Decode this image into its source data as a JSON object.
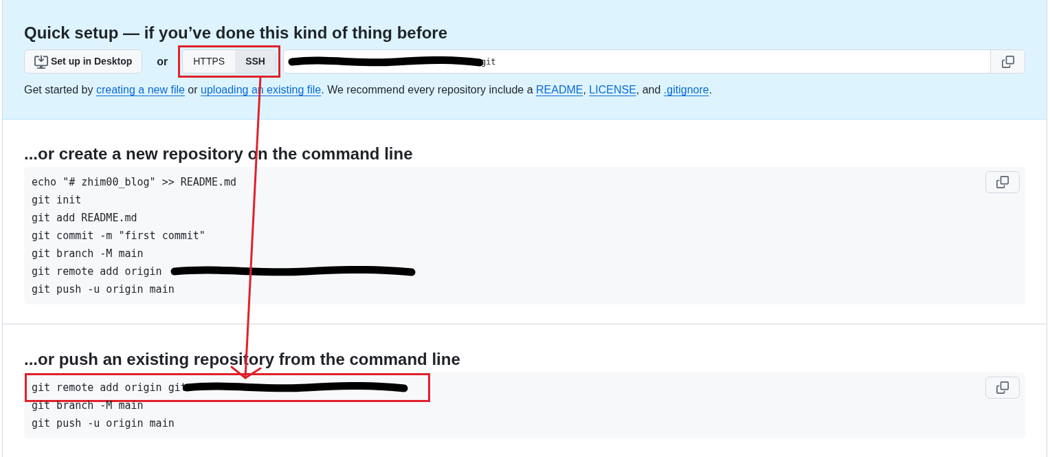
{
  "quick_setup": {
    "title": "Quick setup — if you’ve done this kind of thing before",
    "desktop_button": "Set up in Desktop",
    "separator": "or",
    "protocols_annotated": true,
    "protocols": [
      {
        "label": "HTTPS",
        "selected": false
      },
      {
        "label": "SSH",
        "selected": true
      }
    ],
    "url": {
      "visible_text": "git",
      "redacted": true
    },
    "hint": [
      {
        "text": "Get started by ",
        "kind": "text"
      },
      {
        "text": "creating a new file",
        "kind": "link"
      },
      {
        "text": " or ",
        "kind": "text"
      },
      {
        "text": "uploading an existing file",
        "kind": "link"
      },
      {
        "text": ". We recommend every repository include a ",
        "kind": "text"
      },
      {
        "text": "README",
        "kind": "link"
      },
      {
        "text": ", ",
        "kind": "text"
      },
      {
        "text": "LICENSE",
        "kind": "link"
      },
      {
        "text": ", and ",
        "kind": "text"
      },
      {
        "text": ".gitignore",
        "kind": "link"
      },
      {
        "text": ".",
        "kind": "text"
      }
    ]
  },
  "sections": [
    {
      "title": "...or create a new repository on the command line",
      "lines": [
        {
          "text": "echo \"# zhim00_blog\" >> README.md",
          "redacted": false,
          "annotated": false
        },
        {
          "text": "git init",
          "redacted": false,
          "annotated": false
        },
        {
          "text": "git add README.md",
          "redacted": false,
          "annotated": false
        },
        {
          "text": "git commit -m \"first commit\"",
          "redacted": false,
          "annotated": false
        },
        {
          "text": "git branch -M main",
          "redacted": false,
          "annotated": false
        },
        {
          "text": "git remote add origin",
          "redacted": true,
          "annotated": false
        },
        {
          "text": "git push -u origin main",
          "redacted": false,
          "annotated": false
        }
      ]
    },
    {
      "title": "...or push an existing repository from the command line",
      "lines": [
        {
          "text": "git remote add origin git",
          "redacted": true,
          "annotated": true
        },
        {
          "text": "git branch -M main",
          "redacted": false,
          "annotated": false
        },
        {
          "text": "git push -u origin main",
          "redacted": false,
          "annotated": false
        }
      ]
    }
  ]
}
